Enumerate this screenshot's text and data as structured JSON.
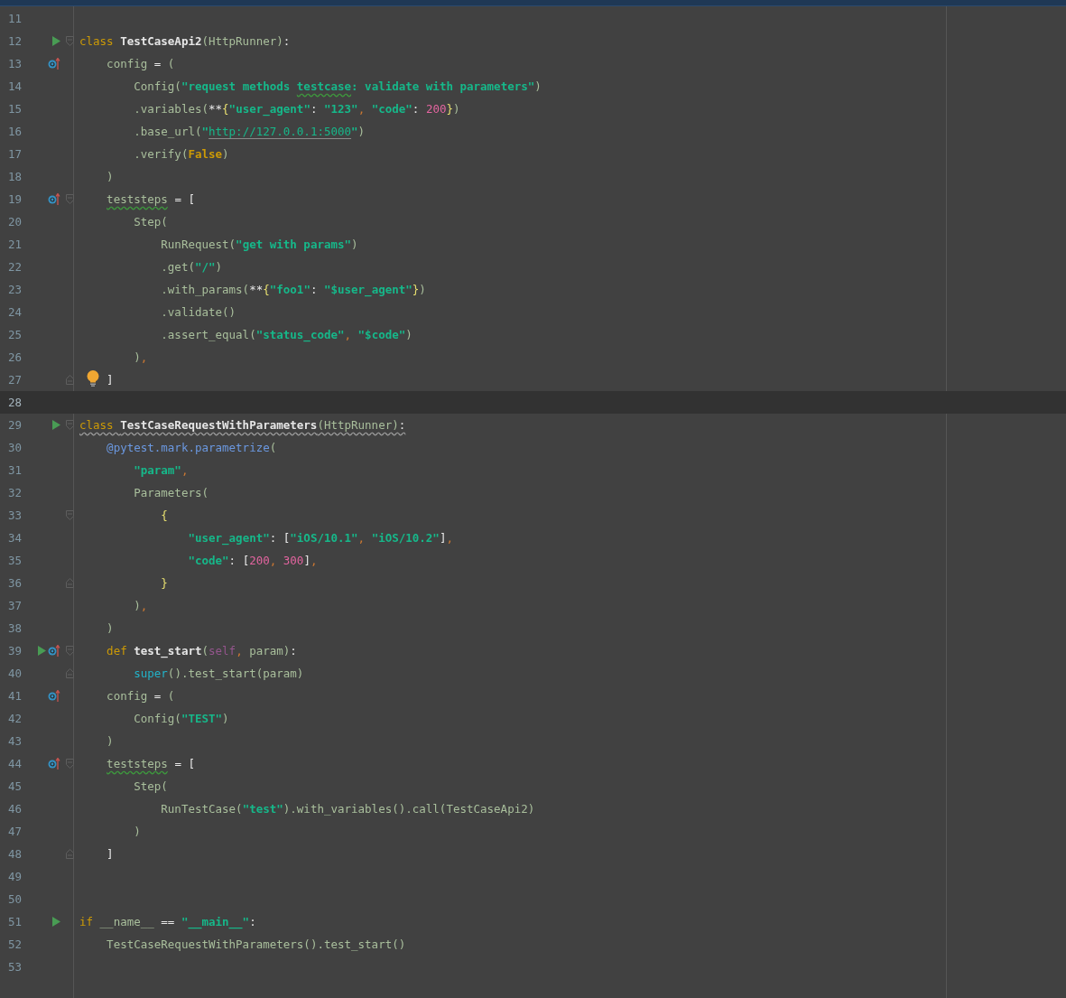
{
  "editor": {
    "lines": [
      {
        "number": "11",
        "current": false
      },
      {
        "number": "12",
        "current": false,
        "warning": false,
        "gutter": [
          {
            "kind": "run"
          }
        ],
        "fold": {
          "kind": "open"
        },
        "tokens": [
          {
            "t": "class ",
            "kind": "kw"
          },
          {
            "t": "TestCaseApi2",
            "kind": "name"
          },
          {
            "t": "(HttpRunner)",
            "kind": "plain"
          },
          {
            "t": ":",
            "kind": "bright"
          }
        ]
      },
      {
        "number": "13",
        "current": false,
        "warning": false,
        "gutter": [
          {
            "kind": "override"
          }
        ],
        "tokens": [
          {
            "t": "    config ",
            "kind": "plain"
          },
          {
            "t": "=",
            "kind": "bright"
          },
          {
            "t": " (",
            "kind": "plain"
          }
        ]
      },
      {
        "number": "14",
        "current": false,
        "warning": false,
        "tokens": [
          {
            "t": "        Config(",
            "kind": "plain"
          },
          {
            "t": "\"request methods ",
            "kind": "str"
          },
          {
            "t": "testcase",
            "kind": "typostr"
          },
          {
            "t": ": validate with parameters\"",
            "kind": "str"
          },
          {
            "t": ")",
            "kind": "plain"
          }
        ]
      },
      {
        "number": "15",
        "current": false,
        "warning": false,
        "tokens": [
          {
            "t": "        .variables(",
            "kind": "plain"
          },
          {
            "t": "**",
            "kind": "bright"
          },
          {
            "t": "{",
            "kind": "brace"
          },
          {
            "t": "\"user_agent\"",
            "kind": "str"
          },
          {
            "t": ": ",
            "kind": "bright"
          },
          {
            "t": "\"123\"",
            "kind": "str"
          },
          {
            "t": ", ",
            "kind": "comma"
          },
          {
            "t": "\"code\"",
            "kind": "str"
          },
          {
            "t": ": ",
            "kind": "bright"
          },
          {
            "t": "200",
            "kind": "num"
          },
          {
            "t": "}",
            "kind": "brace"
          },
          {
            "t": ")",
            "kind": "plain"
          }
        ]
      },
      {
        "number": "16",
        "current": false,
        "warning": false,
        "tokens": [
          {
            "t": "        .base_url(",
            "kind": "plain"
          },
          {
            "t": "\"",
            "kind": "str"
          },
          {
            "t": "http://127.0.0.1:5000",
            "kind": "url"
          },
          {
            "t": "\"",
            "kind": "str"
          },
          {
            "t": ")",
            "kind": "plain"
          }
        ]
      },
      {
        "number": "17",
        "current": false,
        "warning": false,
        "tokens": [
          {
            "t": "        .verify(",
            "kind": "plain"
          },
          {
            "t": "False",
            "kind": "const"
          },
          {
            "t": ")",
            "kind": "plain"
          }
        ]
      },
      {
        "number": "18",
        "current": false,
        "warning": false,
        "tokens": [
          {
            "t": "    )",
            "kind": "plain"
          }
        ]
      },
      {
        "number": "19",
        "current": false,
        "warning": false,
        "gutter": [
          {
            "kind": "override"
          }
        ],
        "fold": {
          "kind": "open"
        },
        "tokens": [
          {
            "t": "    teststeps",
            "kind": "typo"
          },
          {
            "t": " = [",
            "kind": "bright"
          }
        ]
      },
      {
        "number": "20",
        "current": false,
        "warning": false,
        "tokens": [
          {
            "t": "        Step(",
            "kind": "plain"
          }
        ]
      },
      {
        "number": "21",
        "current": false,
        "warning": false,
        "tokens": [
          {
            "t": "            RunRequest(",
            "kind": "plain"
          },
          {
            "t": "\"get with params\"",
            "kind": "str"
          },
          {
            "t": ")",
            "kind": "plain"
          }
        ]
      },
      {
        "number": "22",
        "current": false,
        "warning": false,
        "tokens": [
          {
            "t": "            .get(",
            "kind": "plain"
          },
          {
            "t": "\"/\"",
            "kind": "str"
          },
          {
            "t": ")",
            "kind": "plain"
          }
        ]
      },
      {
        "number": "23",
        "current": false,
        "warning": false,
        "tokens": [
          {
            "t": "            .with_params(",
            "kind": "plain"
          },
          {
            "t": "**",
            "kind": "bright"
          },
          {
            "t": "{",
            "kind": "brace"
          },
          {
            "t": "\"foo1\"",
            "kind": "str"
          },
          {
            "t": ": ",
            "kind": "bright"
          },
          {
            "t": "\"$user_agent\"",
            "kind": "str"
          },
          {
            "t": "}",
            "kind": "brace"
          },
          {
            "t": ")",
            "kind": "plain"
          }
        ]
      },
      {
        "number": "24",
        "current": false,
        "warning": false,
        "tokens": [
          {
            "t": "            .validate()",
            "kind": "plain"
          }
        ]
      },
      {
        "number": "25",
        "current": false,
        "warning": false,
        "tokens": [
          {
            "t": "            .assert_equal(",
            "kind": "plain"
          },
          {
            "t": "\"status_code\"",
            "kind": "str"
          },
          {
            "t": ", ",
            "kind": "comma"
          },
          {
            "t": "\"$code\"",
            "kind": "str"
          },
          {
            "t": ")",
            "kind": "plain"
          }
        ]
      },
      {
        "number": "26",
        "current": false,
        "warning": false,
        "tokens": [
          {
            "t": "        )",
            "kind": "plain"
          },
          {
            "t": ",",
            "kind": "comma"
          }
        ]
      },
      {
        "number": "27",
        "current": false,
        "warning": false,
        "fold": {
          "kind": "close"
        },
        "bulb": true,
        "tokens": [
          {
            "t": "    ]",
            "kind": "bright"
          }
        ]
      },
      {
        "number": "28",
        "current": true
      },
      {
        "number": "29",
        "current": false,
        "warning": true,
        "gutter": [
          {
            "kind": "run"
          }
        ],
        "fold": {
          "kind": "open"
        },
        "tokens": [
          {
            "t": "class ",
            "kind": "kw"
          },
          {
            "t": "TestCaseRequestWithParameters",
            "kind": "name"
          },
          {
            "t": "(HttpRunner)",
            "kind": "plain"
          },
          {
            "t": ":",
            "kind": "bright"
          }
        ]
      },
      {
        "number": "30",
        "current": false,
        "warning": false,
        "tokens": [
          {
            "t": "    @pytest.mark.parametrize",
            "kind": "deco"
          },
          {
            "t": "(",
            "kind": "plain"
          }
        ]
      },
      {
        "number": "31",
        "current": false,
        "warning": false,
        "tokens": [
          {
            "t": "        \"param\"",
            "kind": "str"
          },
          {
            "t": ",",
            "kind": "comma"
          }
        ]
      },
      {
        "number": "32",
        "current": false,
        "warning": false,
        "tokens": [
          {
            "t": "        Parameters(",
            "kind": "plain"
          }
        ]
      },
      {
        "number": "33",
        "current": false,
        "warning": false,
        "fold": {
          "kind": "open"
        },
        "tokens": [
          {
            "t": "            {",
            "kind": "brace"
          }
        ]
      },
      {
        "number": "34",
        "current": false,
        "warning": false,
        "tokens": [
          {
            "t": "                \"user_agent\"",
            "kind": "str"
          },
          {
            "t": ": [",
            "kind": "bright"
          },
          {
            "t": "\"iOS/10.1\"",
            "kind": "str"
          },
          {
            "t": ", ",
            "kind": "comma"
          },
          {
            "t": "\"iOS/10.2\"",
            "kind": "str"
          },
          {
            "t": "]",
            "kind": "bright"
          },
          {
            "t": ",",
            "kind": "comma"
          }
        ]
      },
      {
        "number": "35",
        "current": false,
        "warning": false,
        "tokens": [
          {
            "t": "                \"code\"",
            "kind": "str"
          },
          {
            "t": ": [",
            "kind": "bright"
          },
          {
            "t": "200",
            "kind": "num"
          },
          {
            "t": ", ",
            "kind": "comma"
          },
          {
            "t": "300",
            "kind": "num"
          },
          {
            "t": "]",
            "kind": "bright"
          },
          {
            "t": ",",
            "kind": "comma"
          }
        ]
      },
      {
        "number": "36",
        "current": false,
        "warning": false,
        "fold": {
          "kind": "close"
        },
        "tokens": [
          {
            "t": "            }",
            "kind": "brace"
          }
        ]
      },
      {
        "number": "37",
        "current": false,
        "warning": false,
        "tokens": [
          {
            "t": "        )",
            "kind": "plain"
          },
          {
            "t": ",",
            "kind": "comma"
          }
        ]
      },
      {
        "number": "38",
        "current": false,
        "warning": false,
        "tokens": [
          {
            "t": "    )",
            "kind": "plain"
          }
        ]
      },
      {
        "number": "39",
        "current": false,
        "warning": false,
        "gutter": [
          {
            "kind": "run"
          },
          {
            "kind": "override"
          }
        ],
        "fold": {
          "kind": "open"
        },
        "tokens": [
          {
            "t": "    def ",
            "kind": "kw"
          },
          {
            "t": "test_start",
            "kind": "name"
          },
          {
            "t": "(",
            "kind": "plain"
          },
          {
            "t": "self",
            "kind": "self"
          },
          {
            "t": ", ",
            "kind": "comma"
          },
          {
            "t": "param)",
            "kind": "plain"
          },
          {
            "t": ":",
            "kind": "bright"
          }
        ]
      },
      {
        "number": "40",
        "current": false,
        "warning": false,
        "fold": {
          "kind": "close"
        },
        "tokens": [
          {
            "t": "        super",
            "kind": "builtin"
          },
          {
            "t": "().test_start(param)",
            "kind": "plain"
          }
        ]
      },
      {
        "number": "41",
        "current": false,
        "warning": false,
        "gutter": [
          {
            "kind": "override"
          }
        ],
        "tokens": [
          {
            "t": "    config ",
            "kind": "plain"
          },
          {
            "t": "=",
            "kind": "bright"
          },
          {
            "t": " (",
            "kind": "plain"
          }
        ]
      },
      {
        "number": "42",
        "current": false,
        "warning": false,
        "tokens": [
          {
            "t": "        Config(",
            "kind": "plain"
          },
          {
            "t": "\"TEST\"",
            "kind": "str"
          },
          {
            "t": ")",
            "kind": "plain"
          }
        ]
      },
      {
        "number": "43",
        "current": false,
        "warning": false,
        "tokens": [
          {
            "t": "    )",
            "kind": "plain"
          }
        ]
      },
      {
        "number": "44",
        "current": false,
        "warning": false,
        "gutter": [
          {
            "kind": "override"
          }
        ],
        "fold": {
          "kind": "open"
        },
        "tokens": [
          {
            "t": "    teststeps",
            "kind": "typo"
          },
          {
            "t": " = [",
            "kind": "bright"
          }
        ]
      },
      {
        "number": "45",
        "current": false,
        "warning": false,
        "tokens": [
          {
            "t": "        Step(",
            "kind": "plain"
          }
        ]
      },
      {
        "number": "46",
        "current": false,
        "warning": false,
        "tokens": [
          {
            "t": "            RunTestCase(",
            "kind": "plain"
          },
          {
            "t": "\"test\"",
            "kind": "str"
          },
          {
            "t": ").with_variables().call(TestCaseApi2)",
            "kind": "plain"
          }
        ]
      },
      {
        "number": "47",
        "current": false,
        "warning": false,
        "tokens": [
          {
            "t": "        )",
            "kind": "plain"
          }
        ]
      },
      {
        "number": "48",
        "current": false,
        "warning": false,
        "fold": {
          "kind": "close"
        },
        "tokens": [
          {
            "t": "    ]",
            "kind": "bright"
          }
        ]
      },
      {
        "number": "49",
        "current": false
      },
      {
        "number": "50",
        "current": false
      },
      {
        "number": "51",
        "current": false,
        "warning": false,
        "gutter": [
          {
            "kind": "run"
          }
        ],
        "tokens": [
          {
            "t": "if ",
            "kind": "kw"
          },
          {
            "t": "__name__ ",
            "kind": "plain"
          },
          {
            "t": "== ",
            "kind": "bright"
          },
          {
            "t": "\"__main__\"",
            "kind": "str"
          },
          {
            "t": ":",
            "kind": "bright"
          }
        ]
      },
      {
        "number": "52",
        "current": false,
        "warning": false,
        "tokens": [
          {
            "t": "    TestCaseRequestWithParameters().test_start()",
            "kind": "plain"
          }
        ]
      },
      {
        "number": "53",
        "current": false
      }
    ]
  }
}
